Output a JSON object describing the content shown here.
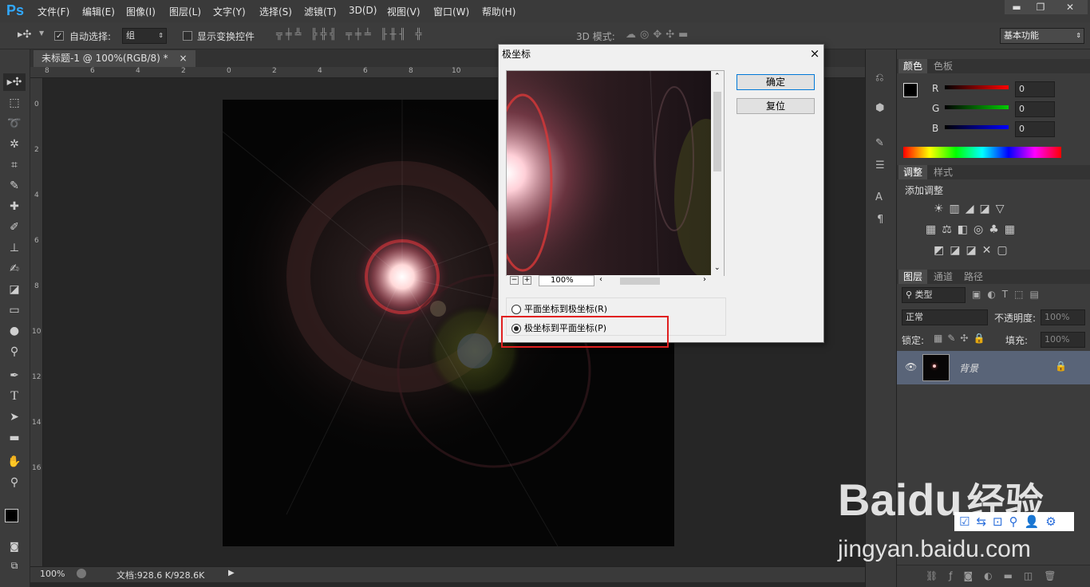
{
  "app": {
    "logo": "Ps"
  },
  "menu": [
    "文件(F)",
    "编辑(E)",
    "图像(I)",
    "图层(L)",
    "文字(Y)",
    "选择(S)",
    "滤镜(T)",
    "3D(D)",
    "视图(V)",
    "窗口(W)",
    "帮助(H)"
  ],
  "options": {
    "auto_select_label": "自动选择:",
    "auto_select_value": "组",
    "show_transform_label": "显示变换控件",
    "mode_3d_label": "3D 模式:",
    "workspace": "基本功能"
  },
  "document": {
    "tab_title": "未标题-1 @ 100%(RGB/8) *",
    "close": "×"
  },
  "ruler_h": [
    "8",
    "6",
    "4",
    "2",
    "0",
    "2",
    "4",
    "6",
    "8",
    "10"
  ],
  "ruler_v": [
    "0",
    "2",
    "4",
    "6",
    "8",
    "10",
    "12",
    "14",
    "16"
  ],
  "status": {
    "zoom": "100%",
    "doc_info": "文档:928.6 K/928.6K"
  },
  "dialog": {
    "title": "极坐标",
    "close": "×",
    "ok": "确定",
    "reset": "复位",
    "zoom": "100%",
    "options": [
      {
        "label": "平面坐标到极坐标(R)",
        "selected": false
      },
      {
        "label": "极坐标到平面坐标(P)",
        "selected": true
      }
    ]
  },
  "color_panel": {
    "tabs": [
      "颜色",
      "色板"
    ],
    "channels": [
      {
        "label": "R",
        "value": "0"
      },
      {
        "label": "G",
        "value": "0"
      },
      {
        "label": "B",
        "value": "0"
      }
    ]
  },
  "adjust_panel": {
    "tabs": [
      "调整",
      "样式"
    ],
    "heading": "添加调整"
  },
  "layers_panel": {
    "tabs": [
      "图层",
      "通道",
      "路径"
    ],
    "filter": "类型",
    "blend": "正常",
    "opacity_label": "不透明度:",
    "opacity": "100%",
    "lock_label": "锁定:",
    "fill_label": "填充:",
    "fill": "100%",
    "layer_name": "背景"
  },
  "watermark": {
    "brand": "Baidu",
    "sub": "经验",
    "url": "jingyan.baidu.com"
  },
  "colors": {
    "accent": "#31a8ff",
    "highlight_box": "#e02020"
  }
}
